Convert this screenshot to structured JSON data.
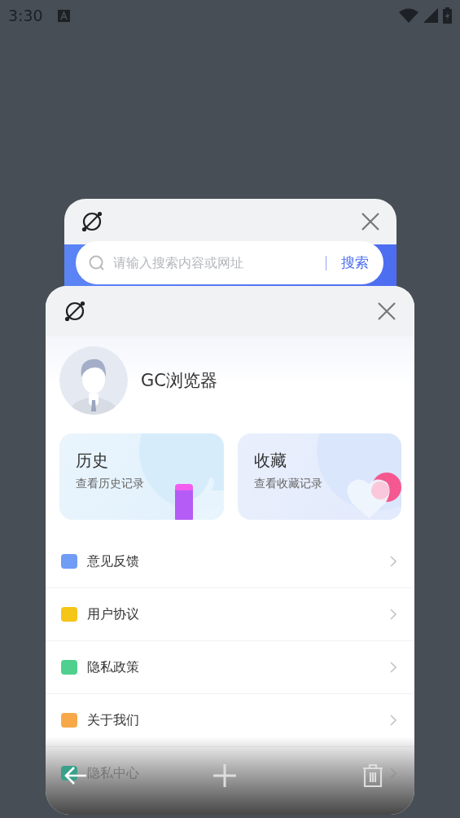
{
  "status_bar": {
    "time": "3:30"
  },
  "back_tab": {
    "search": {
      "placeholder": "请输入搜索内容或网址",
      "button": "搜索"
    }
  },
  "front_tab": {
    "profile": {
      "name": "GC浏览器"
    },
    "cards": [
      {
        "title": "历史",
        "subtitle": "查看历史记录"
      },
      {
        "title": "收藏",
        "subtitle": "查看收藏记录"
      }
    ],
    "menu": [
      {
        "label": "意见反馈",
        "color": "#6f9cf5"
      },
      {
        "label": "用户协议",
        "color": "#f5c518"
      },
      {
        "label": "隐私政策",
        "color": "#4fd08f"
      },
      {
        "label": "关于我们",
        "color": "#f7a94a"
      },
      {
        "label": "隐私中心",
        "color": "#3aa08a"
      }
    ]
  }
}
